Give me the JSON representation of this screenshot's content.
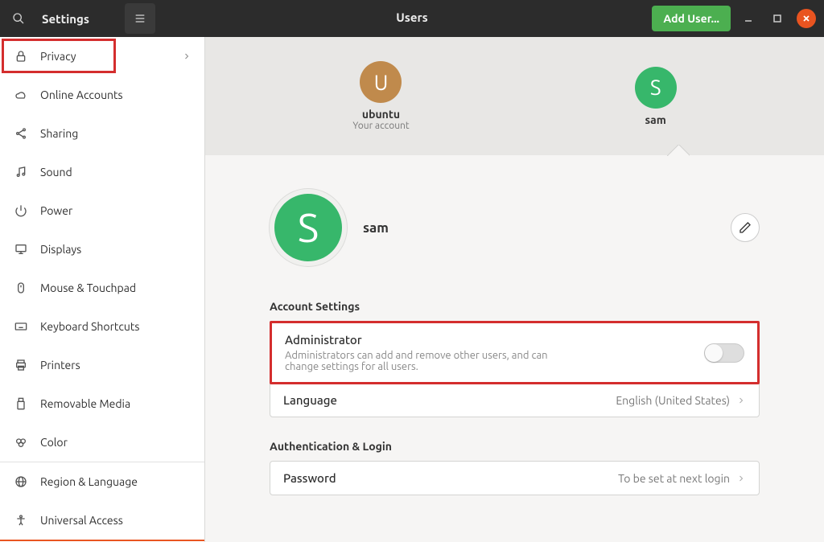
{
  "header": {
    "app_title": "Settings",
    "page_title": "Users",
    "add_user_label": "Add User..."
  },
  "sidebar": {
    "items": [
      {
        "icon": "lock",
        "label": "Privacy",
        "expandable": true
      },
      {
        "icon": "cloud",
        "label": "Online Accounts"
      },
      {
        "icon": "share",
        "label": "Sharing"
      },
      {
        "icon": "music",
        "label": "Sound"
      },
      {
        "icon": "power",
        "label": "Power"
      },
      {
        "icon": "display",
        "label": "Displays"
      },
      {
        "icon": "mouse",
        "label": "Mouse & Touchpad"
      },
      {
        "icon": "keyboard",
        "label": "Keyboard Shortcuts"
      },
      {
        "icon": "printer",
        "label": "Printers"
      },
      {
        "icon": "usb",
        "label": "Removable Media"
      },
      {
        "icon": "color",
        "label": "Color"
      },
      {
        "icon": "globe",
        "label": "Region & Language"
      },
      {
        "icon": "accessibility",
        "label": "Universal Access"
      }
    ]
  },
  "users_strip": [
    {
      "initial": "U",
      "name": "ubuntu",
      "subtitle": "Your account",
      "color": "#c08a4c"
    },
    {
      "initial": "S",
      "name": "sam",
      "subtitle": "",
      "color": "#37b76b",
      "selected": true
    }
  ],
  "current_user": {
    "initial": "S",
    "name": "sam"
  },
  "account_settings": {
    "section_title": "Account Settings",
    "admin": {
      "label": "Administrator",
      "desc": "Administrators can add and remove other users, and can change settings for all users.",
      "enabled": false
    },
    "language": {
      "label": "Language",
      "value": "English (United States)"
    }
  },
  "auth": {
    "section_title": "Authentication & Login",
    "password": {
      "label": "Password",
      "value": "To be set at next login"
    }
  }
}
